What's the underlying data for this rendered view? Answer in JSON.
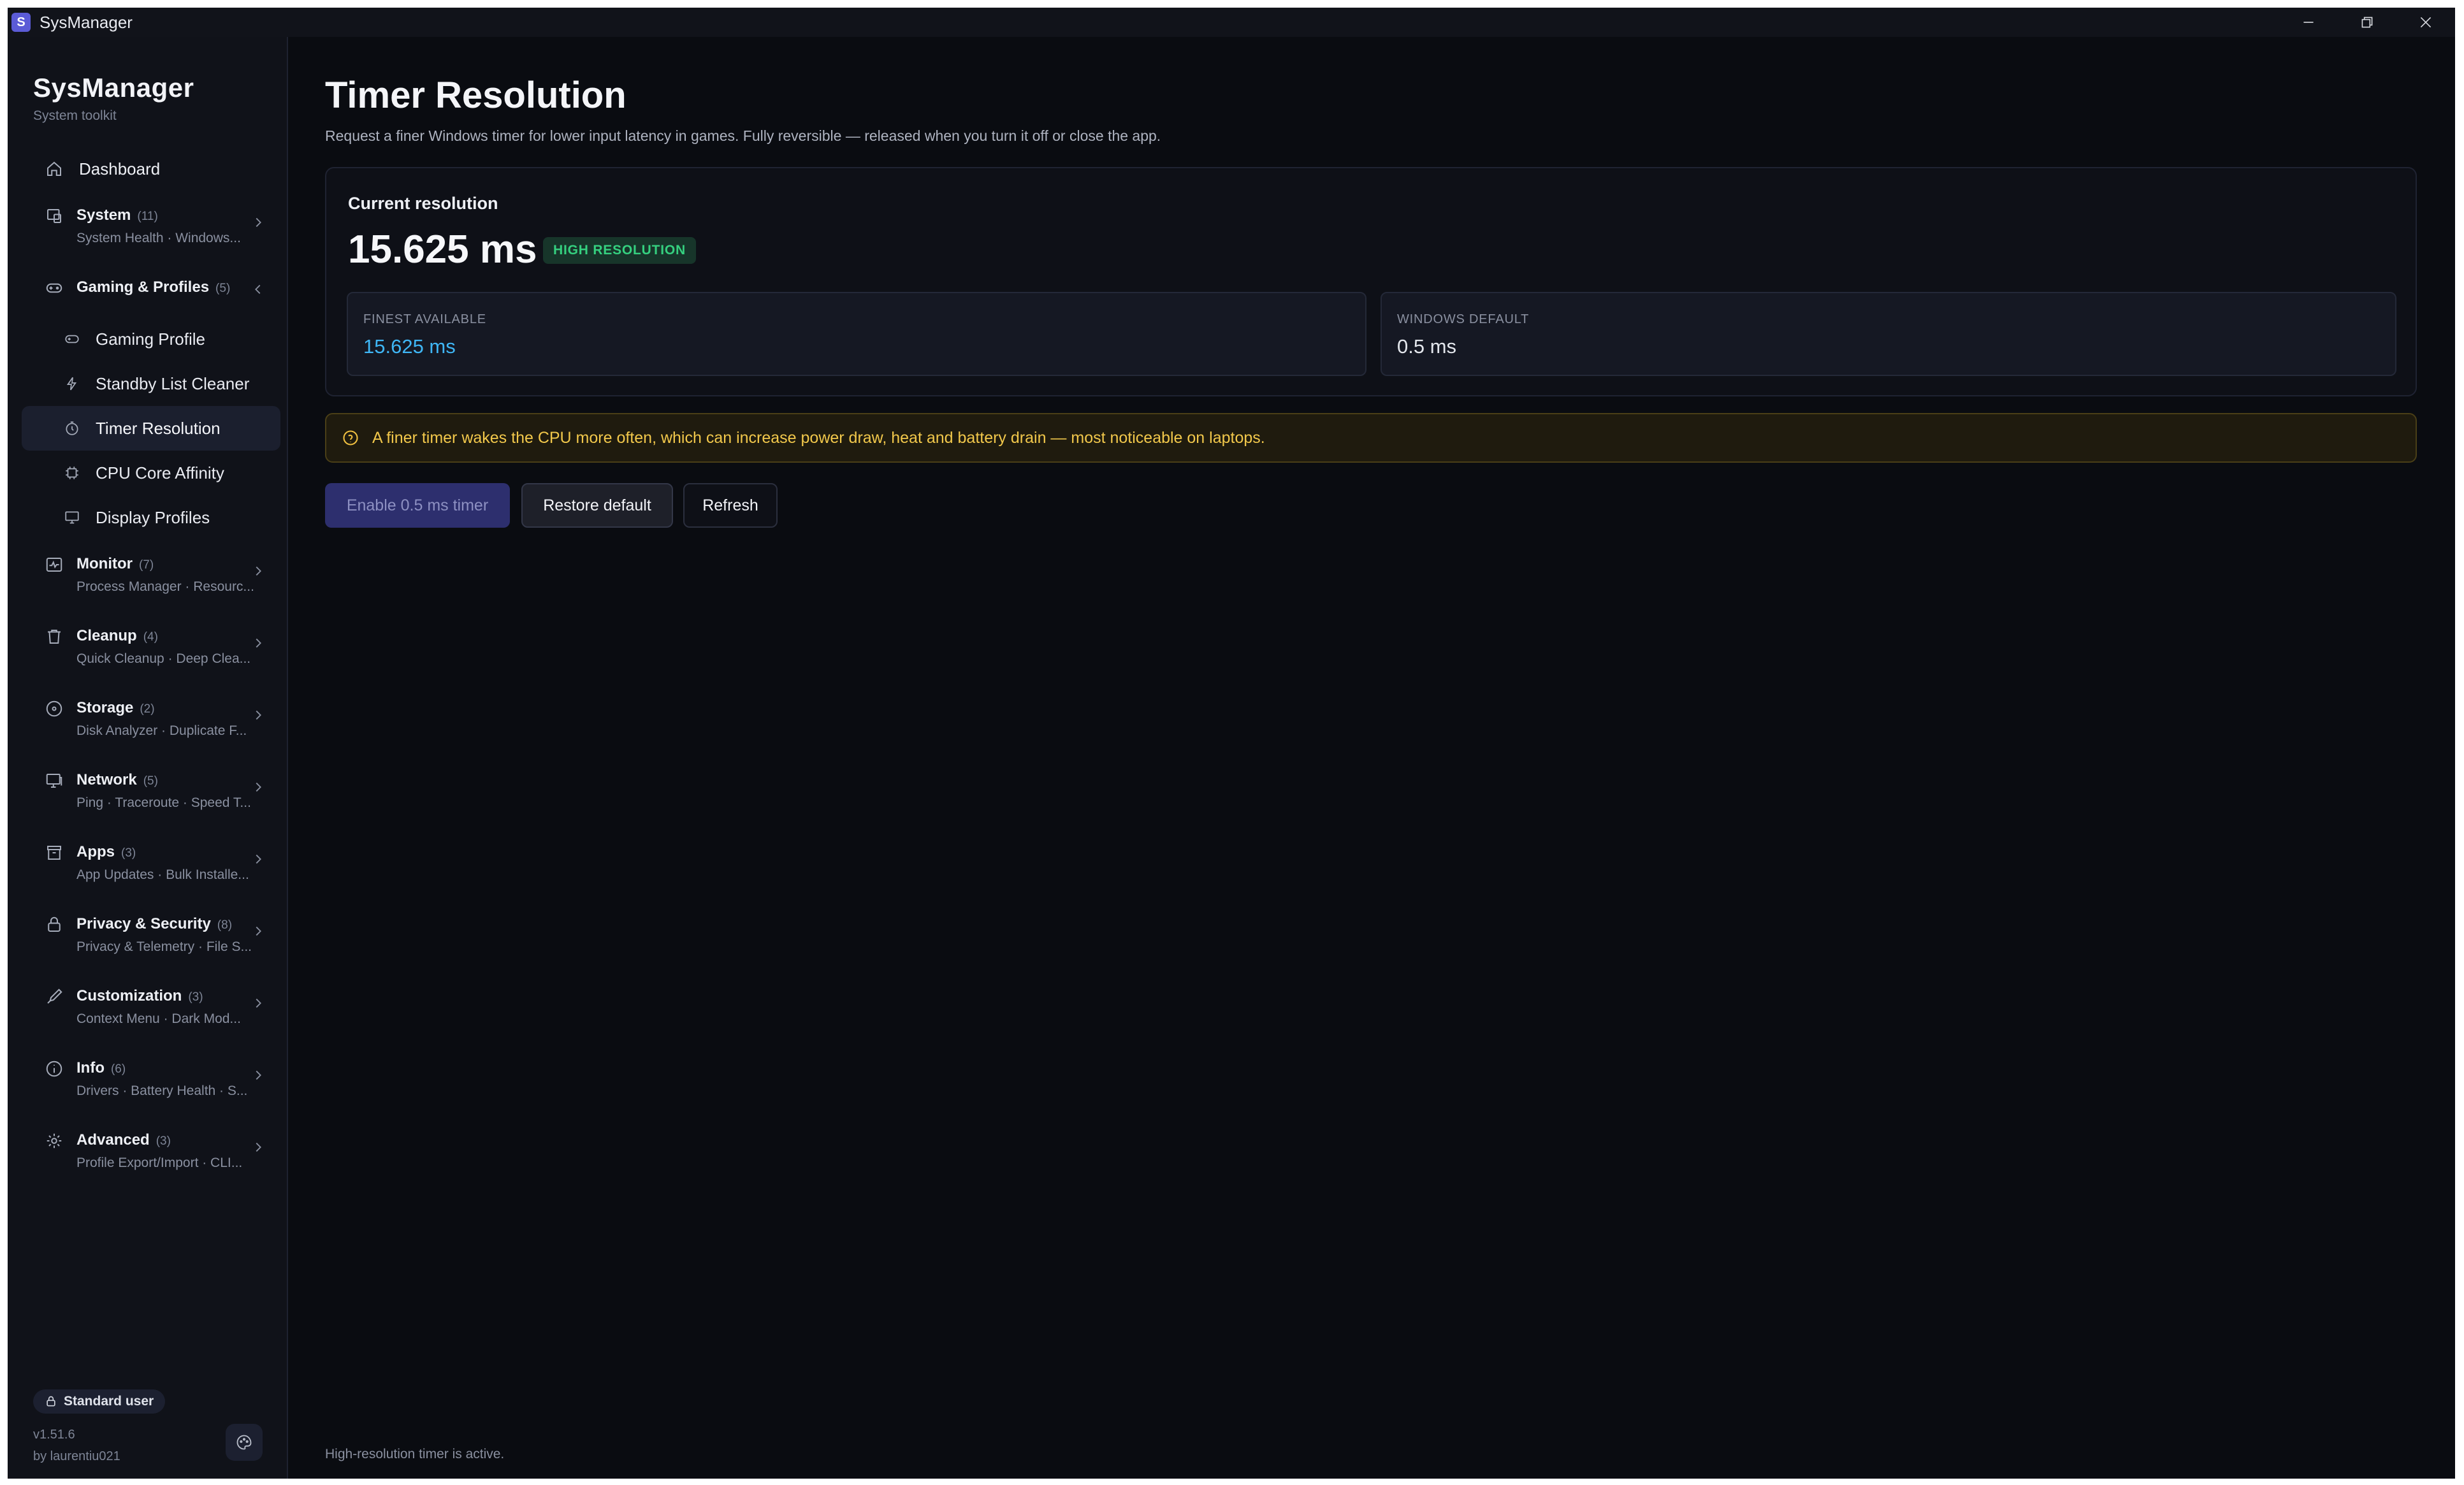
{
  "window": {
    "title": "SysManager",
    "app_icon_letter": "S"
  },
  "sidebar": {
    "brand_title": "SysManager",
    "brand_subtitle": "System toolkit",
    "dashboard_label": "Dashboard",
    "groups": [
      {
        "title": "System",
        "count": "(11)",
        "subtitle": "System Health · Windows..."
      },
      {
        "title": "Gaming & Profiles",
        "count": "(5)",
        "subtitle": ""
      },
      {
        "title": "Monitor",
        "count": "(7)",
        "subtitle": "Process Manager · Resourc..."
      },
      {
        "title": "Cleanup",
        "count": "(4)",
        "subtitle": "Quick Cleanup · Deep Clea..."
      },
      {
        "title": "Storage",
        "count": "(2)",
        "subtitle": "Disk Analyzer · Duplicate F..."
      },
      {
        "title": "Network",
        "count": "(5)",
        "subtitle": "Ping · Traceroute · Speed T..."
      },
      {
        "title": "Apps",
        "count": "(3)",
        "subtitle": "App Updates · Bulk Installe..."
      },
      {
        "title": "Privacy & Security",
        "count": "(8)",
        "subtitle": "Privacy & Telemetry · File S..."
      },
      {
        "title": "Customization",
        "count": "(3)",
        "subtitle": "Context Menu · Dark Mod..."
      },
      {
        "title": "Info",
        "count": "(6)",
        "subtitle": "Drivers · Battery Health · S..."
      },
      {
        "title": "Advanced",
        "count": "(3)",
        "subtitle": "Profile Export/Import · CLI..."
      }
    ],
    "gaming_items": [
      {
        "label": "Gaming Profile",
        "icon": "gamepad-icon"
      },
      {
        "label": "Standby List Cleaner",
        "icon": "bolt-icon"
      },
      {
        "label": "Timer Resolution",
        "icon": "timer-icon",
        "active": true
      },
      {
        "label": "CPU Core Affinity",
        "icon": "cpu-icon"
      },
      {
        "label": "Display Profiles",
        "icon": "monitor-icon"
      }
    ],
    "user_role": "Standard user",
    "version": "v1.51.6",
    "author": "by laurentiu021"
  },
  "main": {
    "title": "Timer Resolution",
    "description": "Request a finer Windows timer for lower input latency in games. Fully reversible — released when you turn it off or close the app.",
    "card": {
      "label": "Current resolution",
      "current_value": "15.625 ms",
      "badge": "HIGH RESOLUTION",
      "finest_label": "FINEST AVAILABLE",
      "finest_value": "15.625 ms",
      "default_label": "WINDOWS DEFAULT",
      "default_value": "0.5 ms"
    },
    "warning": "A finer timer wakes the CPU more often, which can increase power draw, heat and battery drain — most noticeable on laptops.",
    "buttons": {
      "enable": "Enable 0.5 ms timer",
      "restore": "Restore default",
      "refresh": "Refresh"
    },
    "status": "High-resolution timer is active."
  },
  "colors": {
    "background": "#0a0c11",
    "sidebar": "#101219",
    "accent_blue": "#3fb6f5",
    "badge_green": "#35d07f",
    "warning_yellow": "#f2c84b",
    "primary_button": "#2d2f6e"
  }
}
